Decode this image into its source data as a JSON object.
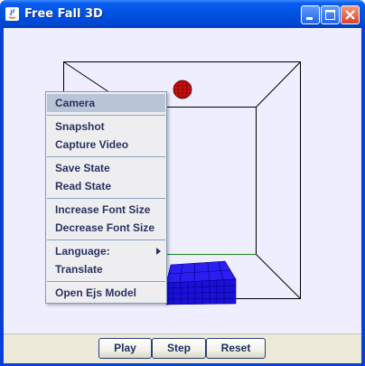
{
  "window": {
    "title": "Free Fall 3D"
  },
  "menu": {
    "items": [
      {
        "label": "Camera"
      },
      {
        "label": "Snapshot"
      },
      {
        "label": "Capture Video"
      },
      {
        "label": "Save State"
      },
      {
        "label": "Read State"
      },
      {
        "label": "Increase Font Size"
      },
      {
        "label": "Decrease Font Size"
      },
      {
        "label": "Language:"
      },
      {
        "label": "Translate"
      },
      {
        "label": "Open Ejs Model"
      }
    ],
    "selected": "Camera"
  },
  "buttons": {
    "play": "Play",
    "step": "Step",
    "reset": "Reset"
  },
  "colors": {
    "background": "#eeeefe",
    "ball": "#cc1010",
    "floor_block": "#1a0fe0",
    "title_bar": "#0054e3"
  },
  "icons": [
    "java-app-icon",
    "minimize-icon",
    "maximize-icon",
    "close-icon",
    "submenu-arrow-icon"
  ]
}
